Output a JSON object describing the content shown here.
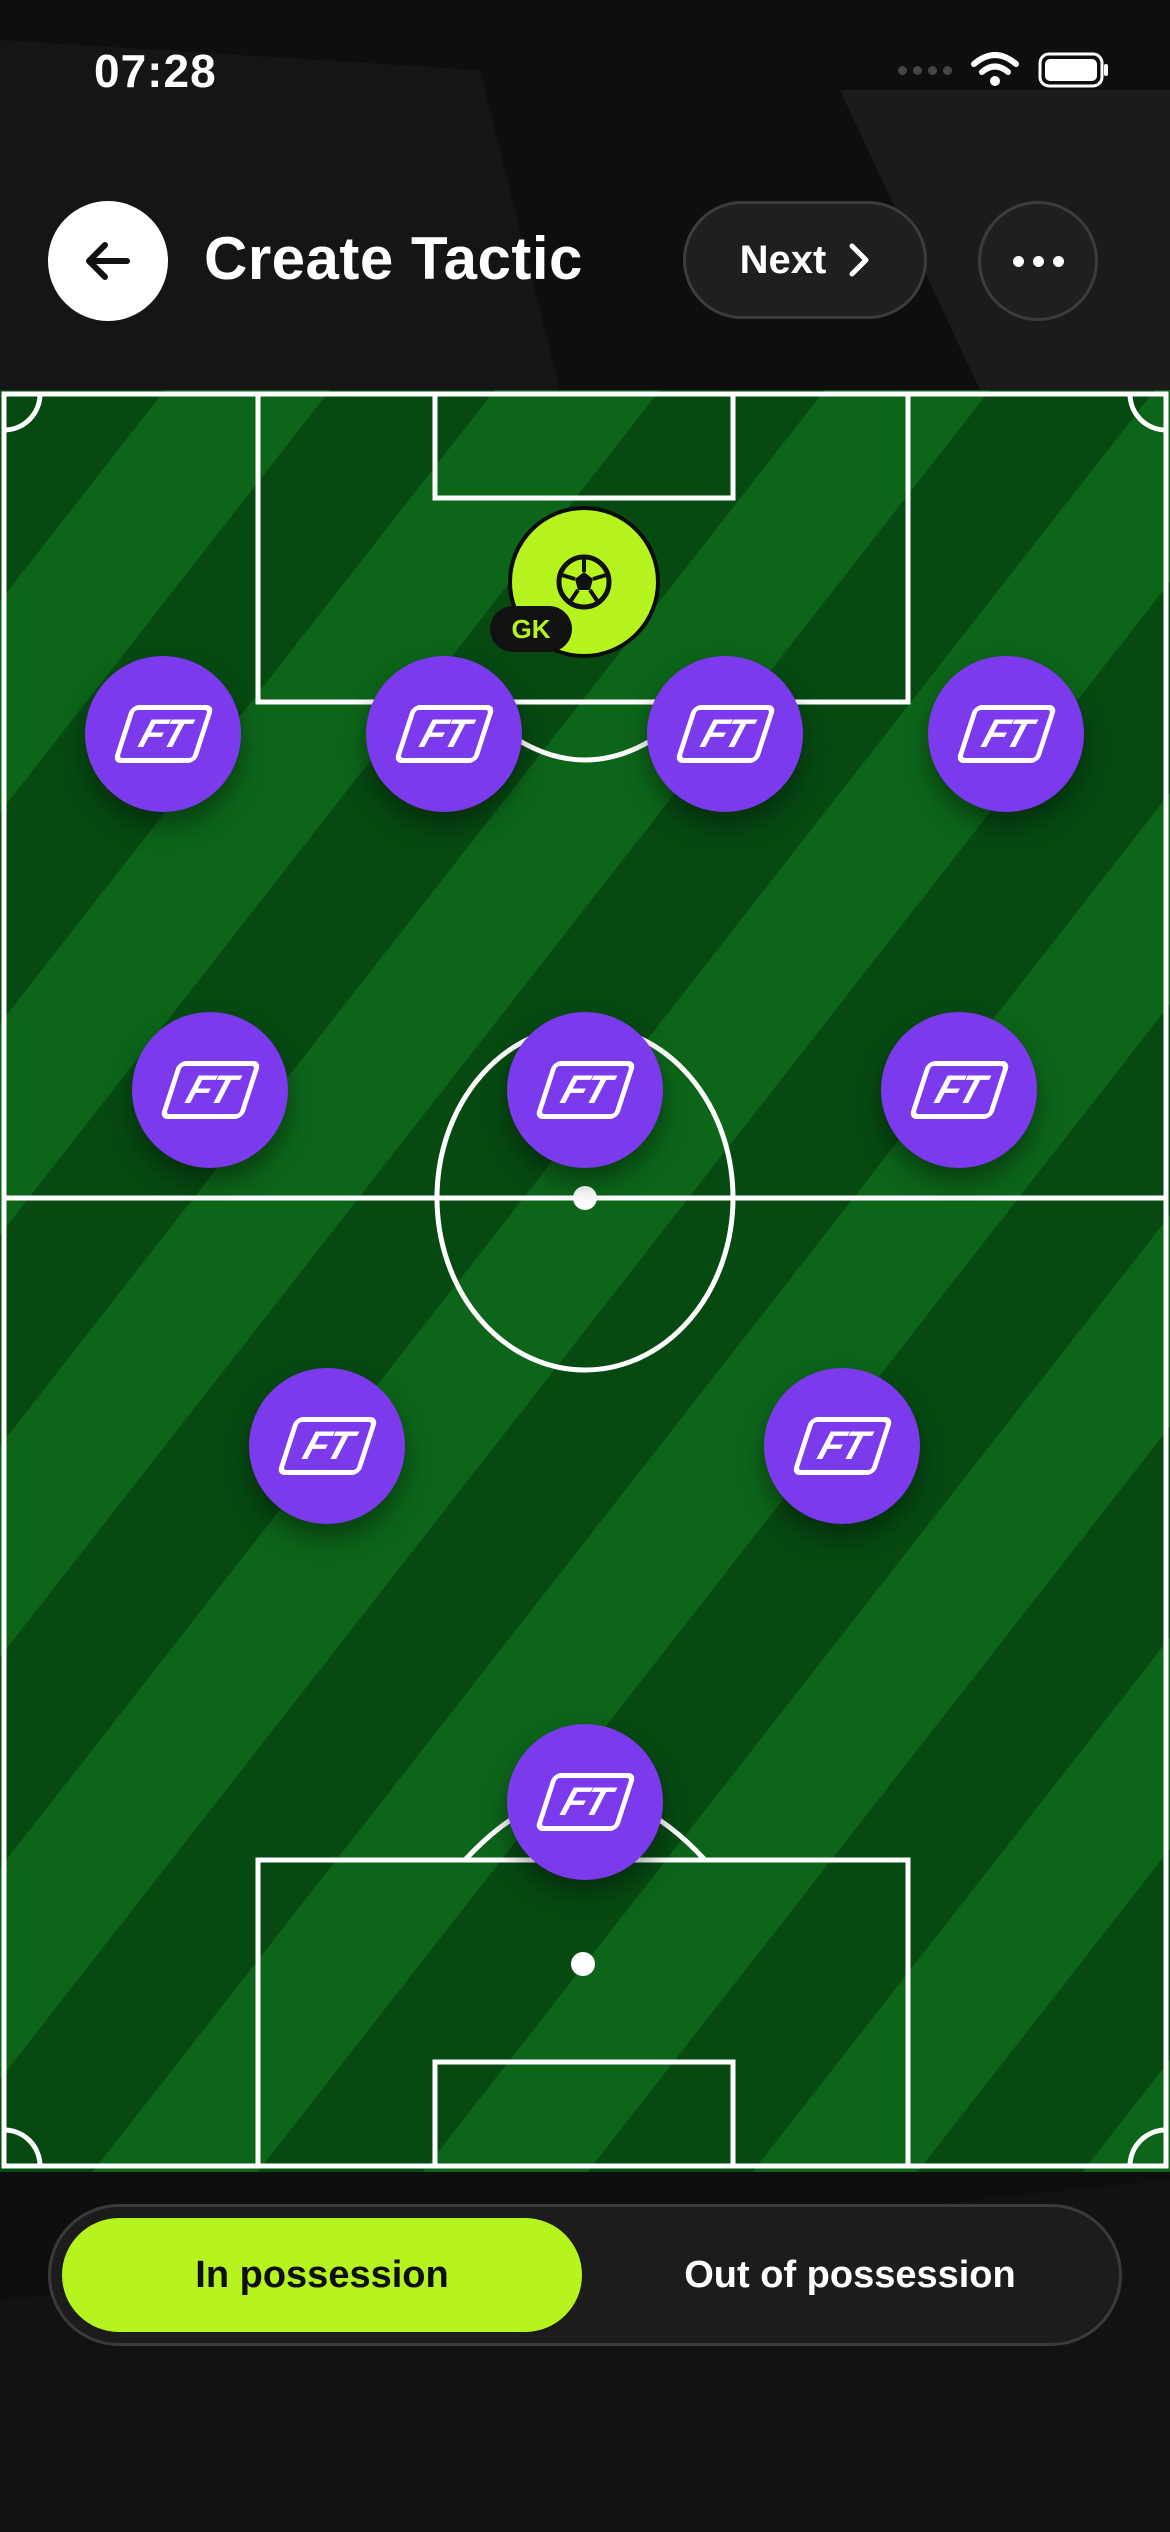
{
  "status_bar": {
    "time": "07:28"
  },
  "header": {
    "title": "Create Tactic",
    "next_label": "Next"
  },
  "colors": {
    "accent": "#b5f41f",
    "player": "#7c3aed",
    "pitch_dark": "#064a12",
    "pitch_light": "#0c6519",
    "background": "#0e0e0e"
  },
  "pitch": {
    "goalkeeper_badge": "GK",
    "player_icon": "FT"
  },
  "possession_toggle": {
    "in_label": "In possession",
    "out_label": "Out of possession",
    "selected": "In possession"
  }
}
